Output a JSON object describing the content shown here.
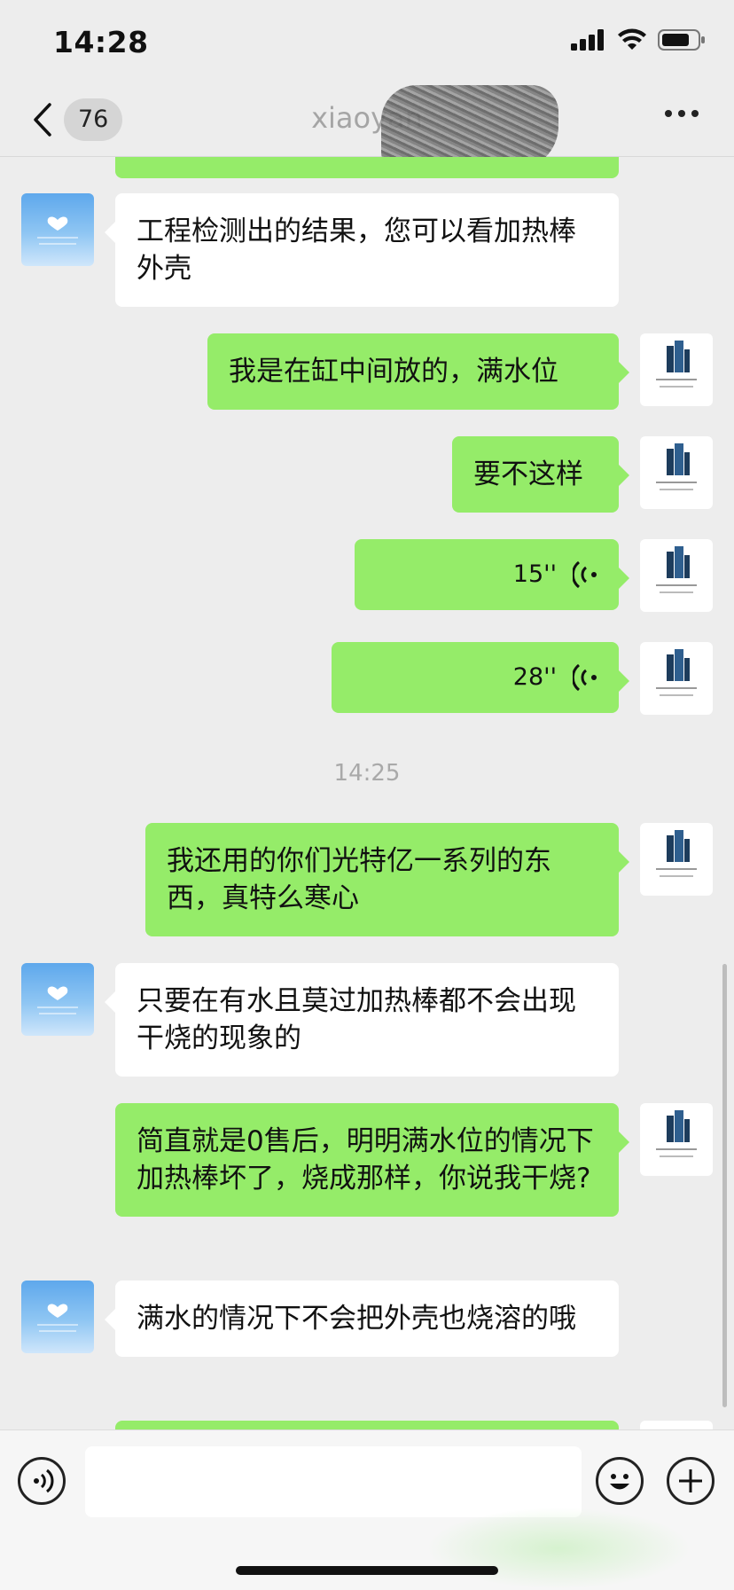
{
  "status_bar": {
    "time": "14:28"
  },
  "nav": {
    "unread_count": "76",
    "title": "xiaoyan"
  },
  "messages": [
    {
      "from": "them",
      "text": "工程检测出的结果，您可以看加热棒外壳"
    },
    {
      "from": "me",
      "text": "我是在缸中间放的，满水位"
    },
    {
      "from": "me",
      "text": "要不这样"
    },
    {
      "from": "me",
      "type": "voice",
      "duration": "15''"
    },
    {
      "from": "me",
      "type": "voice",
      "duration": "28''"
    },
    {
      "type": "time",
      "text": "14:25"
    },
    {
      "from": "me",
      "text": "我还用的你们光特亿一系列的东西，真特么寒心"
    },
    {
      "from": "them",
      "text": "只要在有水且莫过加热棒都不会出现干烧的现象的"
    },
    {
      "from": "me",
      "text": "简直就是0售后，明明满水位的情况下加热棒坏了，烧成那样，你说我干烧?"
    },
    {
      "from": "them",
      "text": "满水的情况下不会把外壳也烧溶的哦"
    }
  ],
  "icons": {
    "back": "chevron-left-icon",
    "more": "more-icon",
    "voice_input": "voice-icon",
    "emoji": "emoji-icon",
    "plus": "plus-icon"
  },
  "colors": {
    "outgoing_bubble": "#95ec69",
    "incoming_bubble": "#ffffff",
    "background": "#ededed"
  }
}
